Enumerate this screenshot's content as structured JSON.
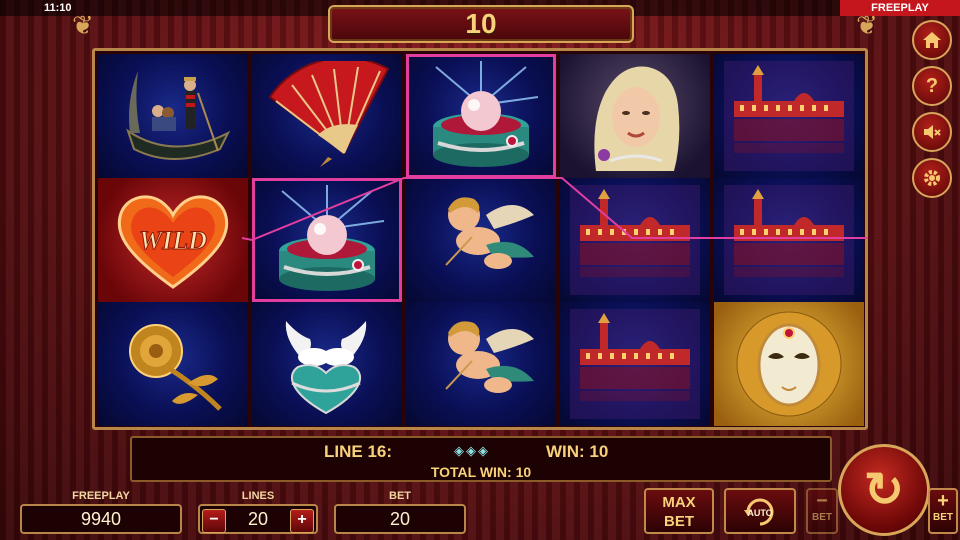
{
  "status_bar": {
    "clock": "11:10",
    "mode_tag": "FREEPLAY"
  },
  "header": {
    "win_display": "10"
  },
  "reels": [
    {
      "symbols": [
        "gondola",
        "wild-heart",
        "golden-rose"
      ],
      "winning": [
        false,
        true,
        false
      ]
    },
    {
      "symbols": [
        "red-fan",
        "pearl-box",
        "doves-box"
      ],
      "winning": [
        false,
        true,
        false
      ]
    },
    {
      "symbols": [
        "pearl-box",
        "cupid",
        "cupid"
      ],
      "winning": [
        true,
        false,
        false
      ]
    },
    {
      "symbols": [
        "lady-portrait",
        "venice-palace",
        "venice-palace"
      ],
      "winning": [
        false,
        false,
        false
      ]
    },
    {
      "symbols": [
        "venice-palace",
        "venice-palace",
        "carnival-mask"
      ],
      "winning": [
        false,
        false,
        false
      ]
    }
  ],
  "wild_text": "WILD",
  "info": {
    "line_label": "LINE 16:",
    "line_icons": "◈◈◈",
    "win_label": "WIN: 10",
    "total_win_label": "TOTAL WIN: 10"
  },
  "controls": {
    "freeplay_label": "FREEPLAY",
    "freeplay_value": "9940",
    "lines_label": "LINES",
    "lines_value": "20",
    "lines_minus": "−",
    "lines_plus": "+",
    "bet_label": "BET",
    "bet_value": "20",
    "max_bet_line1": "MAX",
    "max_bet_line2": "BET",
    "auto_label": "AUTO",
    "bet_minus_label": "BET",
    "bet_minus_symbol": "−",
    "bet_plus_label": "BET",
    "bet_plus_symbol": "+",
    "spin_symbol": "↻"
  },
  "side_buttons": {
    "home_icon": "home-icon",
    "help_label": "?",
    "sound_icon": "sound-muted-icon",
    "settings_icon": "gear-icon"
  },
  "colors": {
    "win_frame": "#e23ea0",
    "gold": "#d7a65a",
    "accent_red": "#c4161c"
  }
}
